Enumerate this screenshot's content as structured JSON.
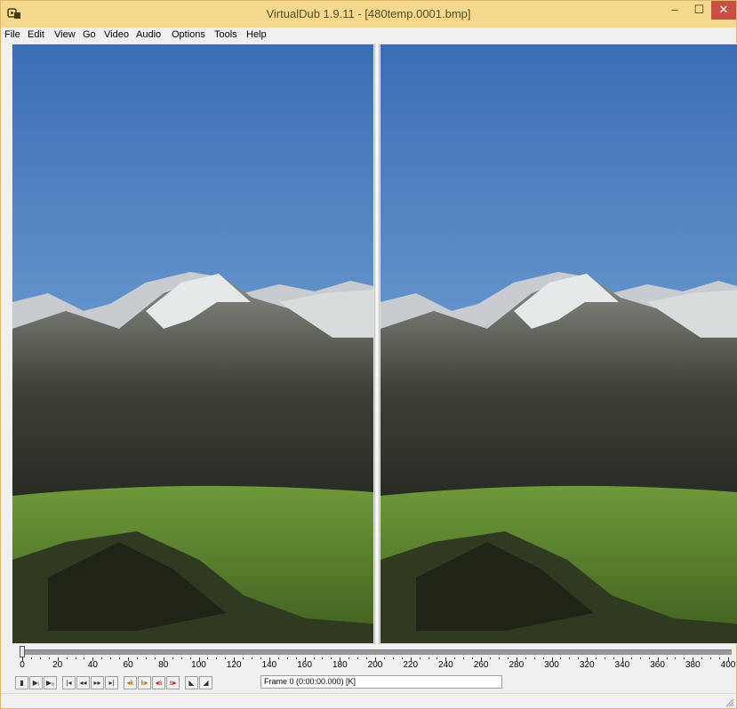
{
  "window": {
    "title": "VirtualDub 1.9.11 - [480temp.0001.bmp]",
    "controls": {
      "minimize": "–",
      "maximize": "☐",
      "close": "✕"
    }
  },
  "menubar": [
    "File",
    "Edit",
    "View",
    "Go",
    "Video",
    "Audio",
    "Options",
    "Tools",
    "Help"
  ],
  "panes": {
    "input": {
      "icon": "mountain-landscape-image"
    },
    "output": {
      "icon": "mountain-landscape-image"
    }
  },
  "timeline": {
    "position": 0,
    "max": 400,
    "tick_labels": [
      "0",
      "20",
      "40",
      "60",
      "80",
      "100",
      "120",
      "140",
      "160",
      "180",
      "200",
      "220",
      "240",
      "260",
      "280",
      "300",
      "320",
      "340",
      "360",
      "380",
      "400"
    ]
  },
  "toolbar": {
    "buttons": [
      {
        "name": "stop-icon",
        "glyph": "▮"
      },
      {
        "name": "play-input-icon",
        "glyph": "▶ᵢ"
      },
      {
        "name": "play-output-icon",
        "glyph": "▶ₒ"
      },
      {
        "name": "go-start-icon",
        "glyph": "|◂"
      },
      {
        "name": "prev-frame-icon",
        "glyph": "◂◂"
      },
      {
        "name": "next-frame-icon",
        "glyph": "▸▸"
      },
      {
        "name": "go-end-icon",
        "glyph": "▸|"
      },
      {
        "name": "prev-key-icon",
        "glyph": "◂k"
      },
      {
        "name": "next-key-icon",
        "glyph": "k▸"
      },
      {
        "name": "prev-scene-icon",
        "glyph": "◂s"
      },
      {
        "name": "next-scene-icon",
        "glyph": "s▸"
      },
      {
        "name": "mark-in-icon",
        "glyph": "◣"
      },
      {
        "name": "mark-out-icon",
        "glyph": "◢"
      }
    ],
    "frame_status": "Frame 0 (0:00:00.000) [K]"
  },
  "colors": {
    "titlebar": "#f6d88f",
    "close": "#c74f44",
    "sky_top": "#3a6db5",
    "sky_horizon": "#b8d4ea",
    "grass": "#5f8a2c"
  }
}
